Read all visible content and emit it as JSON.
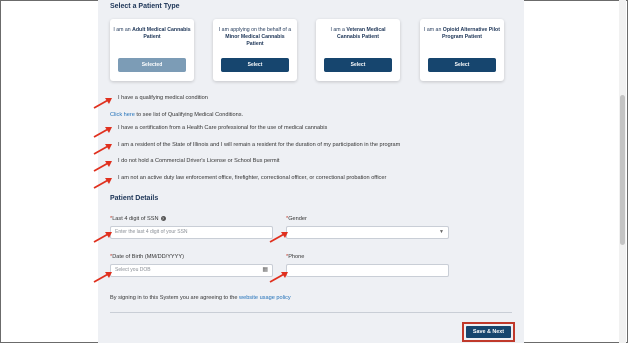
{
  "patient_type": {
    "title": "Select a Patient Type",
    "cards": [
      {
        "pre": "I am an ",
        "bold": "Adult Medical Cannabis Patient",
        "post": "",
        "button": "Selected",
        "selected": true
      },
      {
        "pre": "I am applying on the behalf of a ",
        "bold": "Minor Medical Cannabis Patient",
        "post": "",
        "button": "Select",
        "selected": false
      },
      {
        "pre": "I am a ",
        "bold": "Veteran Medical Cannabis Patient",
        "post": "",
        "button": "Select",
        "selected": false
      },
      {
        "pre": "I am an ",
        "bold": "Opioid Alternative Pilot Program Patient",
        "post": "",
        "button": "Select",
        "selected": false
      }
    ]
  },
  "conditions": {
    "qualifying": "I have a qualifying medical condition",
    "link_text": "Click here",
    "link_suffix": " to see list of Qualifying Medical Conditions.",
    "certification": "I have a certification from a Health Care professional for the use of medical cannabis",
    "resident": "I am a resident of the State of Illinois and I will remain a resident for the duration of my participation in the program",
    "license": "I do not hold a Commercial Driver's License or School Bus permit",
    "law_enforcement": "I am not an active duty law enforcement office, firefighter, correctional officer, or correctional probation officer"
  },
  "patient_details": {
    "title": "Patient Details",
    "ssn_label": "Last 4 digit of SSN",
    "ssn_placeholder": "Enter the last 4 digit of your SSN",
    "gender_label": "Gender",
    "gender_value": "",
    "dob_label": "Date of Birth (MM/DD/YYYY)",
    "dob_placeholder": "Select you DOB",
    "phone_label": "Phone",
    "phone_value": "",
    "required_mark": "*"
  },
  "footer": {
    "signin_text": "By signing in to this System you are agreeing to the ",
    "policy_link": "website usage policy",
    "save_button": "Save & Next"
  },
  "colors": {
    "primary": "#16456e",
    "selected": "#7c9cb6",
    "annotation": "#e0301e",
    "link": "#1f6fb8"
  }
}
